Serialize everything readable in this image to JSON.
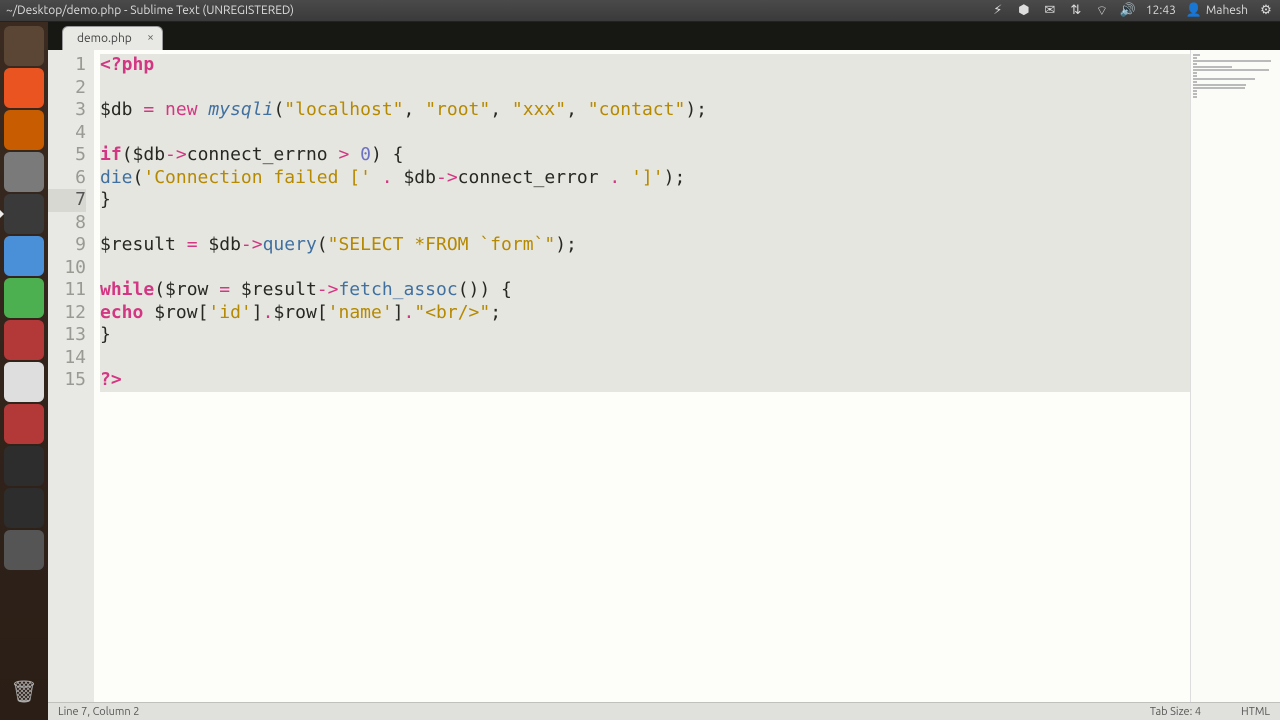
{
  "window": {
    "title": "~/Desktop/demo.php - Sublime Text (UNREGISTERED)"
  },
  "panel": {
    "time": "12:43",
    "user": "Mahesh"
  },
  "launcher": {
    "items": [
      {
        "name": "dash",
        "color": "#5b4636"
      },
      {
        "name": "nautilus",
        "color": "#e95420"
      },
      {
        "name": "firefox",
        "color": "#c85c00"
      },
      {
        "name": "gedit",
        "color": "#7a7a7a"
      },
      {
        "name": "sublime",
        "color": "#3a3a3a",
        "active": true
      },
      {
        "name": "chromium",
        "color": "#4a90d9"
      },
      {
        "name": "libreoffice",
        "color": "#4caf50"
      },
      {
        "name": "settings",
        "color": "#b33939"
      },
      {
        "name": "writer",
        "color": "#dedede"
      },
      {
        "name": "software",
        "color": "#b33939"
      },
      {
        "name": "terminal",
        "color": "#2d2d2d"
      },
      {
        "name": "xchat",
        "color": "#2d2d2d"
      },
      {
        "name": "workspace",
        "color": "#555"
      }
    ]
  },
  "tab": {
    "name": "demo.php"
  },
  "code": {
    "lines": [
      {
        "n": 1,
        "sel": true,
        "tokens": [
          [
            "t-kw",
            "<?php"
          ]
        ]
      },
      {
        "n": 2,
        "sel": true,
        "tokens": []
      },
      {
        "n": 3,
        "sel": true,
        "tokens": [
          [
            "t-var",
            "$db"
          ],
          [
            "",
            " "
          ],
          [
            "t-op",
            "="
          ],
          [
            "",
            " "
          ],
          [
            "t-op",
            "new"
          ],
          [
            "",
            " "
          ],
          [
            "t-cls",
            "mysqli"
          ],
          [
            "t-punc",
            "("
          ],
          [
            "t-str",
            "\"localhost\""
          ],
          [
            "t-punc",
            ", "
          ],
          [
            "t-str",
            "\"root\""
          ],
          [
            "t-punc",
            ", "
          ],
          [
            "t-str",
            "\"xxx\""
          ],
          [
            "t-punc",
            ", "
          ],
          [
            "t-str",
            "\"contact\""
          ],
          [
            "t-punc",
            ");"
          ]
        ]
      },
      {
        "n": 4,
        "sel": true,
        "tokens": []
      },
      {
        "n": 5,
        "sel": true,
        "tokens": [
          [
            "t-kw",
            "if"
          ],
          [
            "t-punc",
            "("
          ],
          [
            "t-var",
            "$db"
          ],
          [
            "t-op",
            "->"
          ],
          [
            "t-var",
            "connect_errno"
          ],
          [
            "",
            " "
          ],
          [
            "t-op",
            ">"
          ],
          [
            "",
            " "
          ],
          [
            "t-num",
            "0"
          ],
          [
            "t-punc",
            ") {"
          ]
        ]
      },
      {
        "n": 6,
        "sel": true,
        "tokens": [
          [
            "t-fn",
            "die"
          ],
          [
            "t-punc",
            "("
          ],
          [
            "t-str",
            "'Connection failed ['"
          ],
          [
            "",
            " "
          ],
          [
            "t-op",
            "."
          ],
          [
            "",
            " "
          ],
          [
            "t-var",
            "$db"
          ],
          [
            "t-op",
            "->"
          ],
          [
            "t-var",
            "connect_error"
          ],
          [
            "",
            " "
          ],
          [
            "t-op",
            "."
          ],
          [
            "",
            " "
          ],
          [
            "t-str",
            "']'"
          ],
          [
            "t-punc",
            ");"
          ]
        ]
      },
      {
        "n": 7,
        "sel": true,
        "current": true,
        "tokens": [
          [
            "t-punc",
            "}"
          ]
        ]
      },
      {
        "n": 8,
        "sel": true,
        "tokens": []
      },
      {
        "n": 9,
        "sel": true,
        "tokens": [
          [
            "t-var",
            "$result"
          ],
          [
            "",
            " "
          ],
          [
            "t-op",
            "="
          ],
          [
            "",
            " "
          ],
          [
            "t-var",
            "$db"
          ],
          [
            "t-op",
            "->"
          ],
          [
            "t-fn",
            "query"
          ],
          [
            "t-punc",
            "("
          ],
          [
            "t-str",
            "\"SELECT *FROM `form`\""
          ],
          [
            "t-punc",
            ");"
          ]
        ]
      },
      {
        "n": 10,
        "sel": true,
        "tokens": []
      },
      {
        "n": 11,
        "sel": true,
        "tokens": [
          [
            "t-kw",
            "while"
          ],
          [
            "t-punc",
            "("
          ],
          [
            "t-var",
            "$row"
          ],
          [
            "",
            " "
          ],
          [
            "t-op",
            "="
          ],
          [
            "",
            " "
          ],
          [
            "t-var",
            "$result"
          ],
          [
            "t-op",
            "->"
          ],
          [
            "t-fn",
            "fetch_assoc"
          ],
          [
            "t-punc",
            "()) {"
          ]
        ]
      },
      {
        "n": 12,
        "sel": true,
        "tokens": [
          [
            "t-kw",
            "echo"
          ],
          [
            "",
            " "
          ],
          [
            "t-var",
            "$row"
          ],
          [
            "t-punc",
            "["
          ],
          [
            "t-str",
            "'id'"
          ],
          [
            "t-punc",
            "]"
          ],
          [
            "t-op",
            "."
          ],
          [
            "t-var",
            "$row"
          ],
          [
            "t-punc",
            "["
          ],
          [
            "t-str",
            "'name'"
          ],
          [
            "t-punc",
            "]"
          ],
          [
            "t-op",
            "."
          ],
          [
            "t-str",
            "\"<br/>\""
          ],
          [
            "t-punc",
            ";"
          ]
        ]
      },
      {
        "n": 13,
        "sel": true,
        "tokens": [
          [
            "t-punc",
            "}"
          ]
        ]
      },
      {
        "n": 14,
        "sel": true,
        "tokens": []
      },
      {
        "n": 15,
        "sel": true,
        "tokens": [
          [
            "t-kw",
            "?>"
          ]
        ]
      }
    ]
  },
  "statusbar": {
    "left": "Line 7, Column 2",
    "tab": "Tab Size: 4",
    "lang": "HTML"
  }
}
